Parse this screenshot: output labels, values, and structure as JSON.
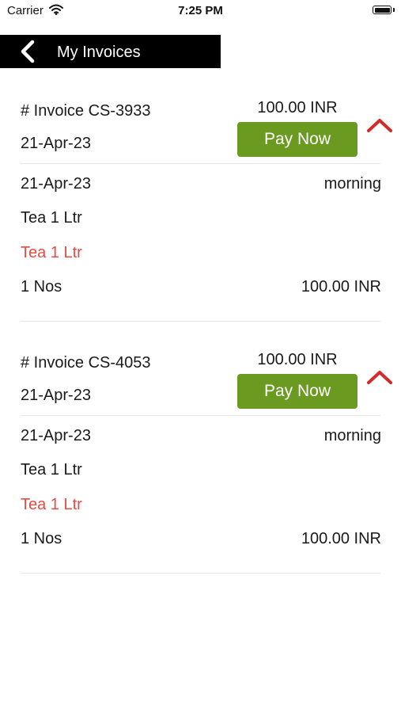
{
  "status_bar": {
    "carrier": "Carrier",
    "time": "7:25 PM"
  },
  "nav": {
    "title": "My Invoices"
  },
  "invoices": [
    {
      "number": "# Invoice CS-3933",
      "date": "21-Apr-23",
      "amount": "100.00 INR",
      "pay_label": "Pay Now",
      "detail": {
        "date": "21-Apr-23",
        "slot": "morning",
        "product": "Tea 1 Ltr",
        "item": "Tea 1 Ltr",
        "quantity": "1 Nos",
        "line_amount": "100.00 INR"
      }
    },
    {
      "number": "# Invoice CS-4053",
      "date": "21-Apr-23",
      "amount": "100.00 INR",
      "pay_label": "Pay Now",
      "detail": {
        "date": "21-Apr-23",
        "slot": "morning",
        "product": "Tea 1 Ltr",
        "item": "Tea 1 Ltr",
        "quantity": "1 Nos",
        "line_amount": "100.00 INR"
      }
    }
  ],
  "colors": {
    "accent_green": "#6a9a1f",
    "highlight_red": "#e84a43",
    "nav_bg": "#000000"
  },
  "icons": {
    "back": "chevron-left-icon",
    "collapse": "chevron-up-icon",
    "wifi": "wifi-icon",
    "battery": "battery-icon"
  }
}
